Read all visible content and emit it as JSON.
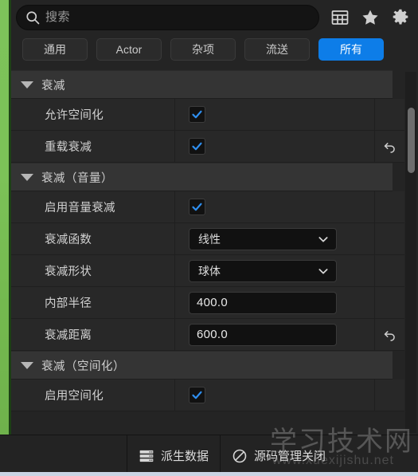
{
  "search": {
    "placeholder": "搜索",
    "value": "",
    "icon": "search-icon"
  },
  "header_icons": [
    {
      "name": "table-grid-icon",
      "label": "表格视图"
    },
    {
      "name": "star-icon",
      "label": "收藏"
    },
    {
      "name": "gear-icon",
      "label": "设置"
    }
  ],
  "filter_tabs": [
    {
      "label": "通用",
      "active": false
    },
    {
      "label": "Actor",
      "active": false
    },
    {
      "label": "杂项",
      "active": false
    },
    {
      "label": "流送",
      "active": false
    },
    {
      "label": "所有",
      "active": true
    }
  ],
  "colors": {
    "accent": "#0d7de8",
    "panel_bg": "#242424",
    "row_bg": "#282828",
    "section_bg": "#343434",
    "field_bg": "#111111",
    "text": "#d2d2d2",
    "viewport_green": "#7dc35a"
  },
  "sections": [
    {
      "title": "衰减",
      "expanded": true,
      "rows": [
        {
          "label": "允许空间化",
          "type": "checkbox",
          "checked": true,
          "reset": false
        },
        {
          "label": "重载衰减",
          "type": "checkbox",
          "checked": true,
          "reset": true
        }
      ]
    },
    {
      "title": "衰减（音量）",
      "expanded": true,
      "rows": [
        {
          "label": "启用音量衰减",
          "type": "checkbox",
          "checked": true,
          "reset": false
        },
        {
          "label": "衰减函数",
          "type": "dropdown",
          "value": "线性",
          "reset": false
        },
        {
          "label": "衰减形状",
          "type": "dropdown",
          "value": "球体",
          "reset": false
        },
        {
          "label": "内部半径",
          "type": "number",
          "value": "400.0",
          "reset": false
        },
        {
          "label": "衰减距离",
          "type": "number",
          "value": "600.0",
          "reset": true
        }
      ]
    },
    {
      "title": "衰减（空间化）",
      "expanded": true,
      "rows": [
        {
          "label": "启用空间化",
          "type": "checkbox",
          "checked": true,
          "reset": false
        }
      ]
    }
  ],
  "scrollbar": {
    "thumb_top_pct": 10,
    "thumb_height_pct": 18
  },
  "statusbar": {
    "items": [
      {
        "label": "派生数据",
        "icon": "database-stack-icon"
      },
      {
        "label": "源码管理关闭",
        "icon": "no-entry-icon"
      }
    ]
  },
  "watermark": {
    "text": "学习技术网",
    "subtext": "www.xuexijishu.net"
  }
}
